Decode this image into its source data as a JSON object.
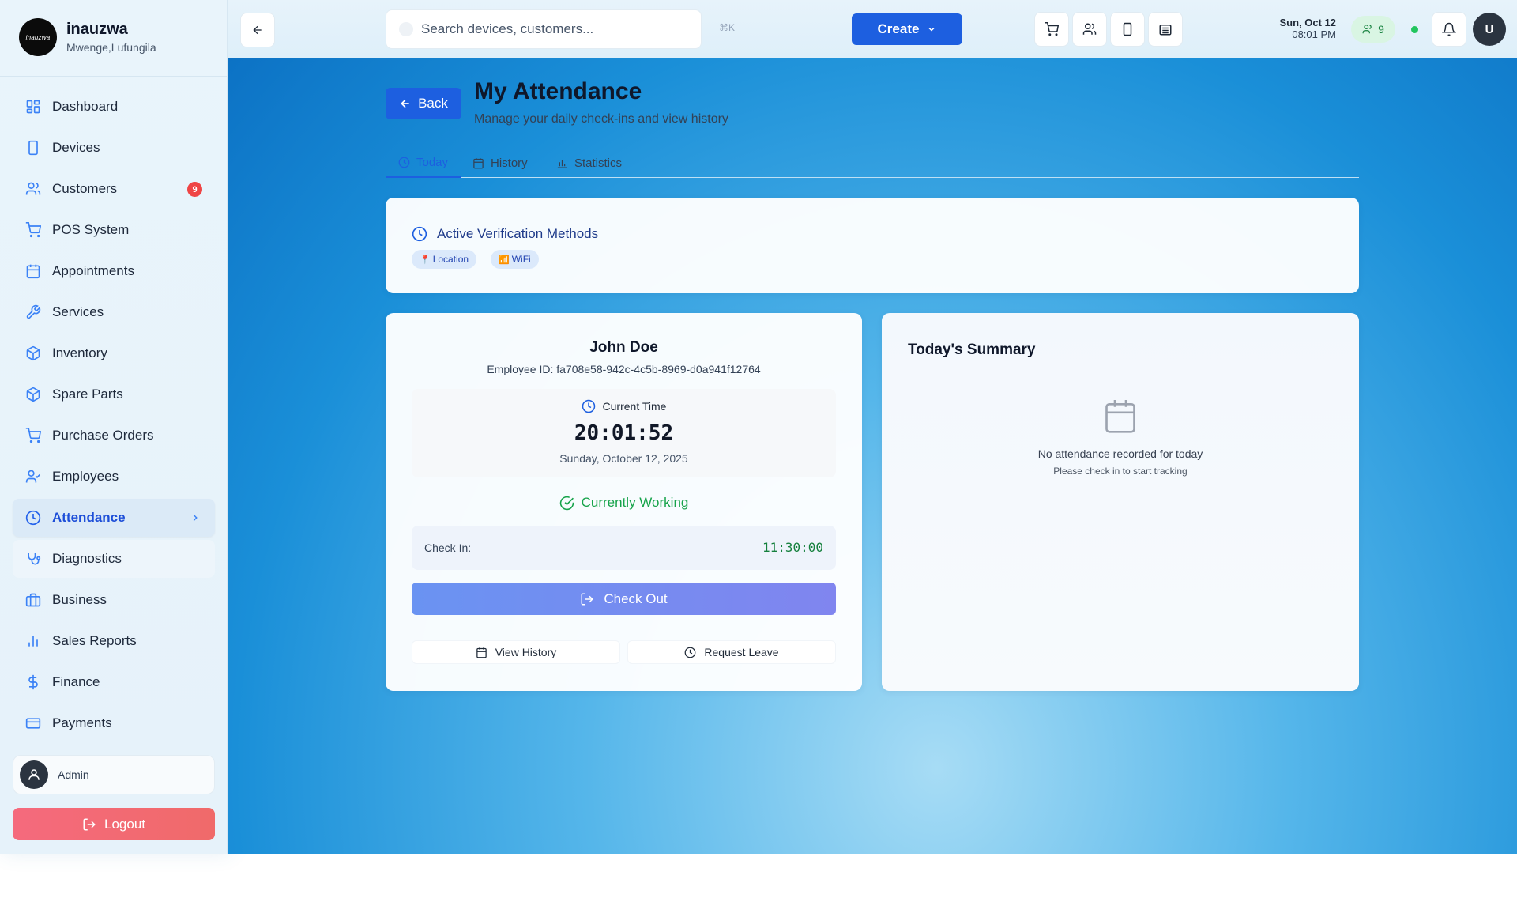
{
  "brand": {
    "logo_text": "inauzwa",
    "name": "inauzwa",
    "location": "Mwenge,Lufungila"
  },
  "sidebar": {
    "items": [
      {
        "label": "Dashboard",
        "icon": "dashboard-icon"
      },
      {
        "label": "Devices",
        "icon": "device-icon"
      },
      {
        "label": "Customers",
        "icon": "customers-icon",
        "badge": "9"
      },
      {
        "label": "POS System",
        "icon": "cart-icon"
      },
      {
        "label": "Appointments",
        "icon": "calendar-icon"
      },
      {
        "label": "Services",
        "icon": "wrench-icon"
      },
      {
        "label": "Inventory",
        "icon": "box-icon"
      },
      {
        "label": "Spare Parts",
        "icon": "box-icon"
      },
      {
        "label": "Purchase Orders",
        "icon": "cart-icon"
      },
      {
        "label": "Employees",
        "icon": "user-check-icon"
      },
      {
        "label": "Attendance",
        "icon": "clock-icon",
        "active": true
      },
      {
        "label": "Diagnostics",
        "icon": "stethoscope-icon"
      },
      {
        "label": "Business",
        "icon": "briefcase-icon"
      },
      {
        "label": "Sales Reports",
        "icon": "bar-chart-icon"
      },
      {
        "label": "Finance",
        "icon": "dollar-icon"
      },
      {
        "label": "Payments",
        "icon": "credit-card-icon"
      }
    ],
    "user": {
      "name": "Admin"
    },
    "logout_label": "Logout"
  },
  "topbar": {
    "search_placeholder": "Search devices, customers...",
    "shortcut": "⌘K",
    "create_label": "Create",
    "date": "Sun, Oct 12",
    "time": "08:01 PM",
    "online_count": "9",
    "user_initial": "U"
  },
  "page": {
    "back_label": "Back",
    "title": "My Attendance",
    "subtitle": "Manage your daily check-ins and view history",
    "tabs": [
      {
        "label": "Today",
        "active": true
      },
      {
        "label": "History"
      },
      {
        "label": "Statistics"
      }
    ]
  },
  "verification": {
    "title": "Active Verification Methods",
    "methods": [
      {
        "label": "Location",
        "emoji": "📍"
      },
      {
        "label": "WiFi",
        "emoji": "📶"
      }
    ]
  },
  "employee": {
    "name": "John Doe",
    "id_line": "Employee ID: fa708e58-942c-4c5b-8969-d0a941f12764",
    "current_time_label": "Current Time",
    "current_time": "20:01:52",
    "current_date": "Sunday, October 12, 2025",
    "status": "Currently Working",
    "check_in_label": "Check In:",
    "check_in_time": "11:30:00",
    "check_out_label": "Check Out",
    "view_history_label": "View History",
    "request_leave_label": "Request Leave"
  },
  "summary": {
    "title": "Today's Summary",
    "empty": "No attendance recorded for today",
    "hint": "Please check in to start tracking"
  },
  "colors": {
    "primary": "#1d5fe0",
    "logout": "#f06a6a",
    "success": "#16a34a",
    "badge": "#ef4444"
  }
}
